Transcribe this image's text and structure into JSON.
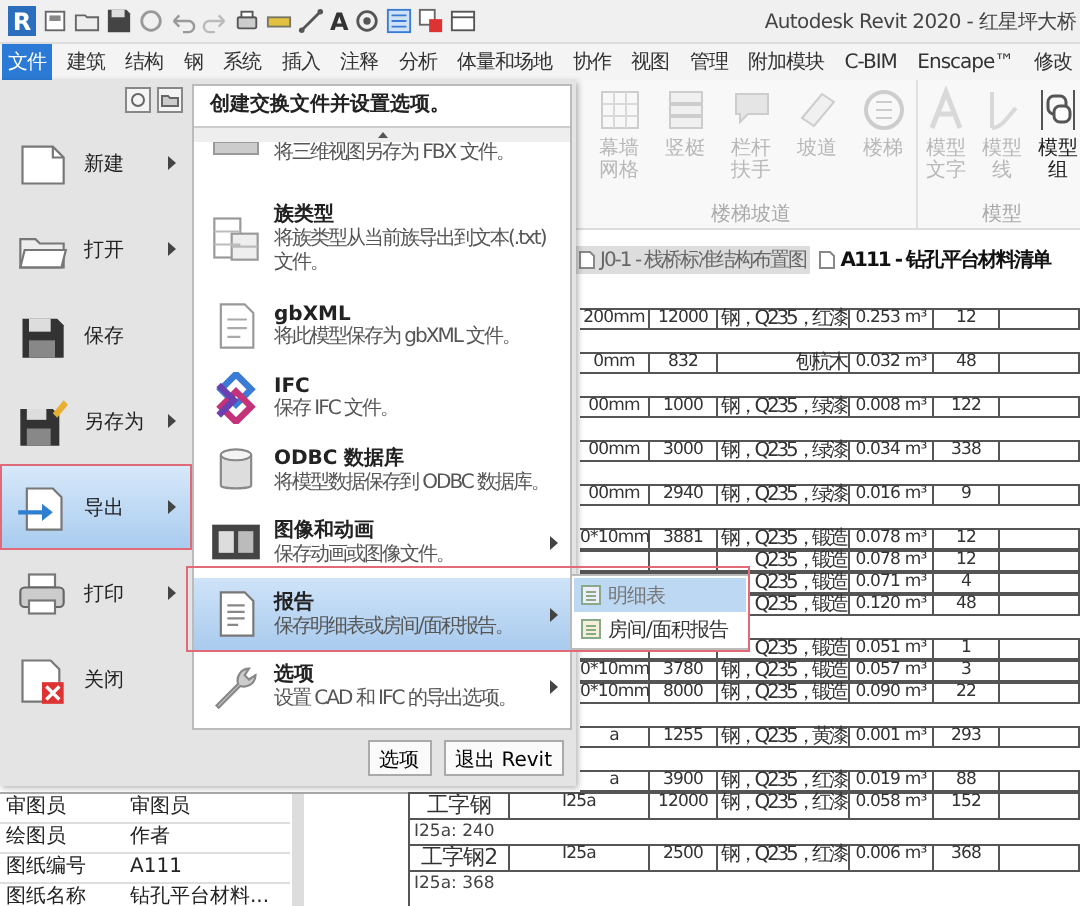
{
  "window": {
    "logo": "R",
    "title": "Autodesk Revit 2020 - 红星坪大桥"
  },
  "quick_access": {
    "text_glyph": "A"
  },
  "menu_tabs": [
    {
      "label": "文件",
      "selected": true
    },
    {
      "label": "建筑",
      "selected": false
    },
    {
      "label": "结构",
      "selected": false
    },
    {
      "label": "钢",
      "selected": false
    },
    {
      "label": "系统",
      "selected": false
    },
    {
      "label": "插入",
      "selected": false
    },
    {
      "label": "注释",
      "selected": false
    },
    {
      "label": "分析",
      "selected": false
    },
    {
      "label": "体量和场地",
      "selected": false
    },
    {
      "label": "协作",
      "selected": false
    },
    {
      "label": "视图",
      "selected": false
    },
    {
      "label": "管理",
      "selected": false
    },
    {
      "label": "附加模块",
      "selected": false
    },
    {
      "label": "C-BIM",
      "selected": false
    },
    {
      "label": "Enscape™",
      "selected": false
    },
    {
      "label": "修改",
      "selected": false
    }
  ],
  "ribbon": {
    "groups": [
      {
        "label": "楼梯坡道",
        "tools": [
          {
            "label": "幕墙网格",
            "disabled": true
          },
          {
            "label": "竖梃",
            "disabled": true
          },
          {
            "label": "栏杆扶手",
            "disabled": true
          },
          {
            "label": "坡道",
            "disabled": true
          },
          {
            "label": "楼梯",
            "disabled": true
          }
        ]
      },
      {
        "label": "模型",
        "tools": [
          {
            "label": "模型文字",
            "disabled": true
          },
          {
            "label": "模型线",
            "disabled": true
          },
          {
            "label": "模型组",
            "disabled": false
          }
        ]
      }
    ]
  },
  "document_tabs": [
    {
      "label": "J0-1 - 栈桥标准结构布置图",
      "selected": false
    },
    {
      "label": "A111 - 钻孔平台材料清单",
      "selected": true
    }
  ],
  "schedule": {
    "upper_rows": [
      {
        "kind": "blank"
      },
      {
        "kind": "data",
        "column_2": "200mm",
        "column_3": "12000",
        "column_4": "钢，Q235，红漆",
        "column_5": "0.253 m³",
        "column_6": "12"
      },
      {
        "kind": "blank"
      },
      {
        "kind": "data",
        "column_2": "0mm",
        "column_3": "832",
        "column_4": "刨杭木",
        "column_5": "0.032 m³",
        "column_6": "48"
      },
      {
        "kind": "blank"
      },
      {
        "kind": "data",
        "column_2": "00mm",
        "column_3": "1000",
        "column_4": "钢，Q235，绿漆",
        "column_5": "0.008 m³",
        "column_6": "122"
      },
      {
        "kind": "blank"
      },
      {
        "kind": "data",
        "column_2": "00mm",
        "column_3": "3000",
        "column_4": "钢，Q235，绿漆",
        "column_5": "0.034 m³",
        "column_6": "338"
      },
      {
        "kind": "blank"
      },
      {
        "kind": "data",
        "column_2": "00mm",
        "column_3": "2940",
        "column_4": "钢，Q235，绿漆",
        "column_5": "0.016 m³",
        "column_6": "9"
      },
      {
        "kind": "blank"
      },
      {
        "kind": "data",
        "column_2": "0*10mm",
        "column_3": "3881",
        "column_4": "钢，Q235，锻造",
        "column_5": "0.078 m³",
        "column_6": "12"
      },
      {
        "kind": "data",
        "column_4": "Q235，锻造",
        "column_5": "0.078 m³",
        "column_6": "12"
      },
      {
        "kind": "data",
        "column_4": "Q235，锻造",
        "column_5": "0.071 m³",
        "column_6": "4"
      },
      {
        "kind": "data",
        "column_4": "Q235，锻造",
        "column_5": "0.120 m³",
        "column_6": "48"
      },
      {
        "kind": "blank"
      },
      {
        "kind": "data",
        "column_4": "Q235，锻造",
        "column_5": "0.051 m³",
        "column_6": "1"
      },
      {
        "kind": "data",
        "column_2": "0*10mm",
        "column_3": "3780",
        "column_4": "钢，Q235，锻造",
        "column_5": "0.057 m³",
        "column_6": "3"
      },
      {
        "kind": "data",
        "column_2": "0*10mm",
        "column_3": "8000",
        "column_4": "钢，Q235，锻造",
        "column_5": "0.090 m³",
        "column_6": "22"
      },
      {
        "kind": "blank"
      },
      {
        "kind": "data",
        "column_2": "a",
        "column_3": "1255",
        "column_4": "钢，Q235，黄漆",
        "column_5": "0.001 m³",
        "column_6": "293"
      },
      {
        "kind": "blank"
      },
      {
        "kind": "data",
        "column_2": "a",
        "column_3": "3900",
        "column_4": "钢，Q235，红漆",
        "column_5": "0.019 m³",
        "column_6": "88"
      }
    ],
    "lower_rows": [
      {
        "kind": "data",
        "column_1": "工字钢",
        "column_2": "I25a",
        "column_3": "12000",
        "column_4": "钢，Q235，红漆",
        "column_5": "0.058 m³",
        "column_6": "152"
      },
      {
        "kind": "footer",
        "text": "I25a: 240"
      },
      {
        "kind": "data",
        "column_1": "工字钢2",
        "column_2": "I25a",
        "column_3": "2500",
        "column_4": "钢，Q235，红漆",
        "column_5": "0.006 m³",
        "column_6": "368"
      },
      {
        "kind": "footer",
        "text": "I25a: 368"
      }
    ]
  },
  "properties": [
    {
      "label": "审图员",
      "value": "审图员"
    },
    {
      "label": "绘图员",
      "value": "作者"
    },
    {
      "label": "图纸编号",
      "value": "A111"
    },
    {
      "label": "图纸名称",
      "value": "钻孔平台材料..."
    }
  ],
  "app_menu": {
    "items": [
      {
        "label": "新建",
        "has_submenu": true,
        "selected": false
      },
      {
        "label": "打开",
        "has_submenu": true,
        "selected": false
      },
      {
        "label": "保存",
        "has_submenu": false,
        "selected": false
      },
      {
        "label": "另存为",
        "has_submenu": true,
        "selected": false
      },
      {
        "label": "导出",
        "has_submenu": true,
        "selected": true
      },
      {
        "label": "打印",
        "has_submenu": true,
        "selected": false
      },
      {
        "label": "关闭",
        "has_submenu": false,
        "selected": false
      }
    ],
    "panel": {
      "header": "创建交换文件并设置选项。",
      "items": [
        {
          "description": "将三维视图另存为 FBX 文件。",
          "has_submenu": false,
          "selected": false
        },
        {
          "title": "族类型",
          "description": "将族类型从当前族导出到文本(.txt)文件。",
          "has_submenu": false,
          "selected": false
        },
        {
          "title": "gbXML",
          "description": "将此模型保存为 gbXML 文件。",
          "has_submenu": false,
          "selected": false
        },
        {
          "title": "IFC",
          "description": "保存 IFC 文件。",
          "has_submenu": false,
          "selected": false
        },
        {
          "title": "ODBC 数据库",
          "description": "将模型数据保存到 ODBC 数据库。",
          "has_submenu": false,
          "selected": false
        },
        {
          "title": "图像和动画",
          "description": "保存动画或图像文件。",
          "has_submenu": true,
          "selected": false
        },
        {
          "title": "报告",
          "description": "保存明细表或房间/面积报告。",
          "has_submenu": true,
          "selected": true
        },
        {
          "title": "选项",
          "description": "设置 CAD 和 IFC 的导出选项。",
          "has_submenu": true,
          "selected": false
        }
      ]
    },
    "flyout": [
      {
        "label": "明细表",
        "selected": true
      },
      {
        "label": "房间/面积报告",
        "selected": false
      }
    ],
    "buttons": [
      "选项",
      "退出 Revit"
    ]
  }
}
